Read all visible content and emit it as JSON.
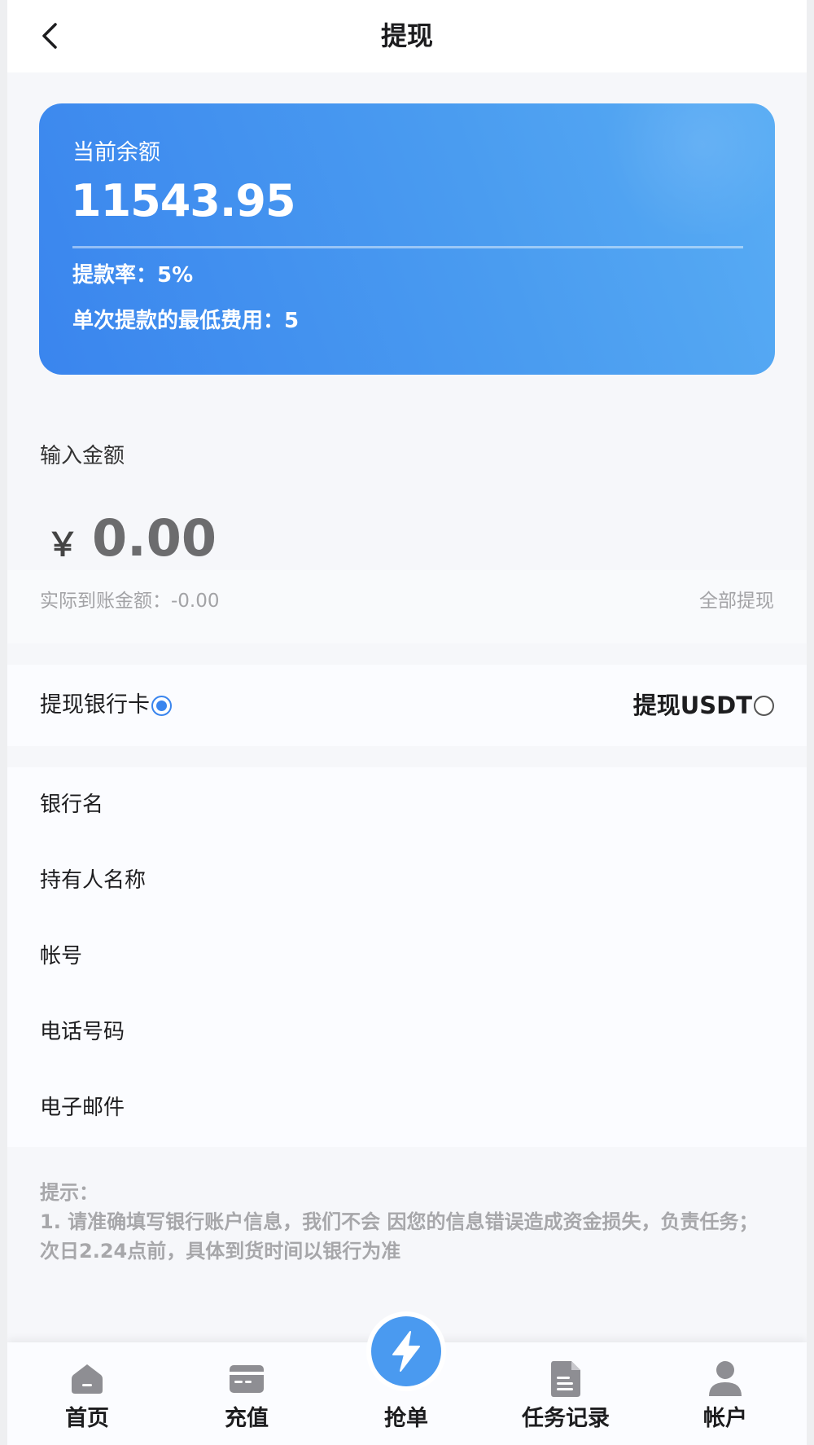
{
  "header": {
    "title": "提现"
  },
  "balance_card": {
    "label": "当前余额",
    "value": "11543.95",
    "rate_text": "提款率：5%",
    "min_fee_text": "单次提款的最低费用：5"
  },
  "amount": {
    "label": "输入金额",
    "currency_symbol": "￥",
    "value": "0.00",
    "actual_text": "实际到账金额：-0.00",
    "withdraw_all": "全部提现"
  },
  "methods": {
    "bank_label": "提现银行卡",
    "usdt_label": "提现USDT",
    "selected": "bank"
  },
  "form": {
    "bank_name": "银行名",
    "holder_name": "持有人名称",
    "account": "帐号",
    "phone": "电话号码",
    "email": "电子邮件"
  },
  "tips": {
    "title": "提示：",
    "line1": "1. 请准确填写银行账户信息，我们不会 因您的信息错误造成资金损失，负责任务；",
    "line2": "次日2.24点前，具体到货时间以银行为准"
  },
  "bottom_nav": {
    "home": "首页",
    "recharge": "充值",
    "grab": "抢单",
    "tasks": "任务记录",
    "account": "帐户"
  },
  "colors": {
    "accent": "#3a85ee",
    "nav_icon": "#8e8e93",
    "tip_text": "#a7a7aa"
  }
}
